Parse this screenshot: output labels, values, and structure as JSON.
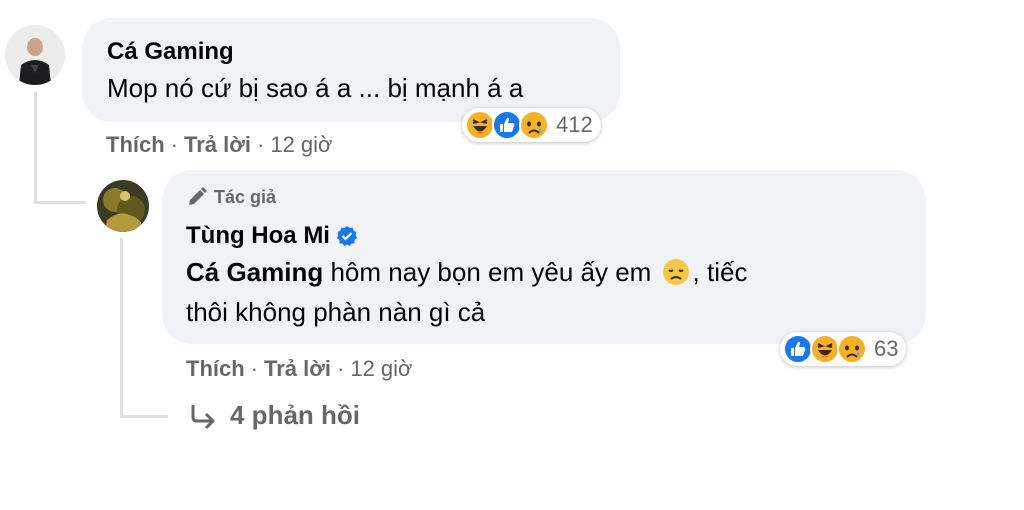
{
  "comment1": {
    "author": "Cá Gaming",
    "text": "Mop nó cứ bị sao á a ... bị mạnh á a",
    "actions": {
      "like": "Thích",
      "reply": "Trả lời",
      "time": "12 giờ"
    },
    "reactions": {
      "icons": [
        "haha-icon",
        "like-icon",
        "sad-icon"
      ],
      "count": "412"
    }
  },
  "reply1": {
    "badge": "Tác giả",
    "author": "Tùng Hoa Mi",
    "mention": "Cá Gaming",
    "text_line1": " hôm nay bọn em yêu ấy em ",
    "text_line1_end": ", tiếc",
    "text_line2": "thôi không phàn nàn gì cả",
    "actions": {
      "like": "Thích",
      "reply": "Trả lời",
      "time": "12 giờ"
    },
    "reactions": {
      "icons": [
        "like-icon",
        "haha-icon",
        "sad-icon"
      ],
      "count": "63"
    }
  },
  "replies_link": {
    "label": "4 phản hồi"
  },
  "colors": {
    "bubble": "#f0f2f5",
    "text": "#050505",
    "secondary": "#65676b",
    "like_blue": "#1877f2",
    "emoji_yellow": "#f7b125"
  }
}
